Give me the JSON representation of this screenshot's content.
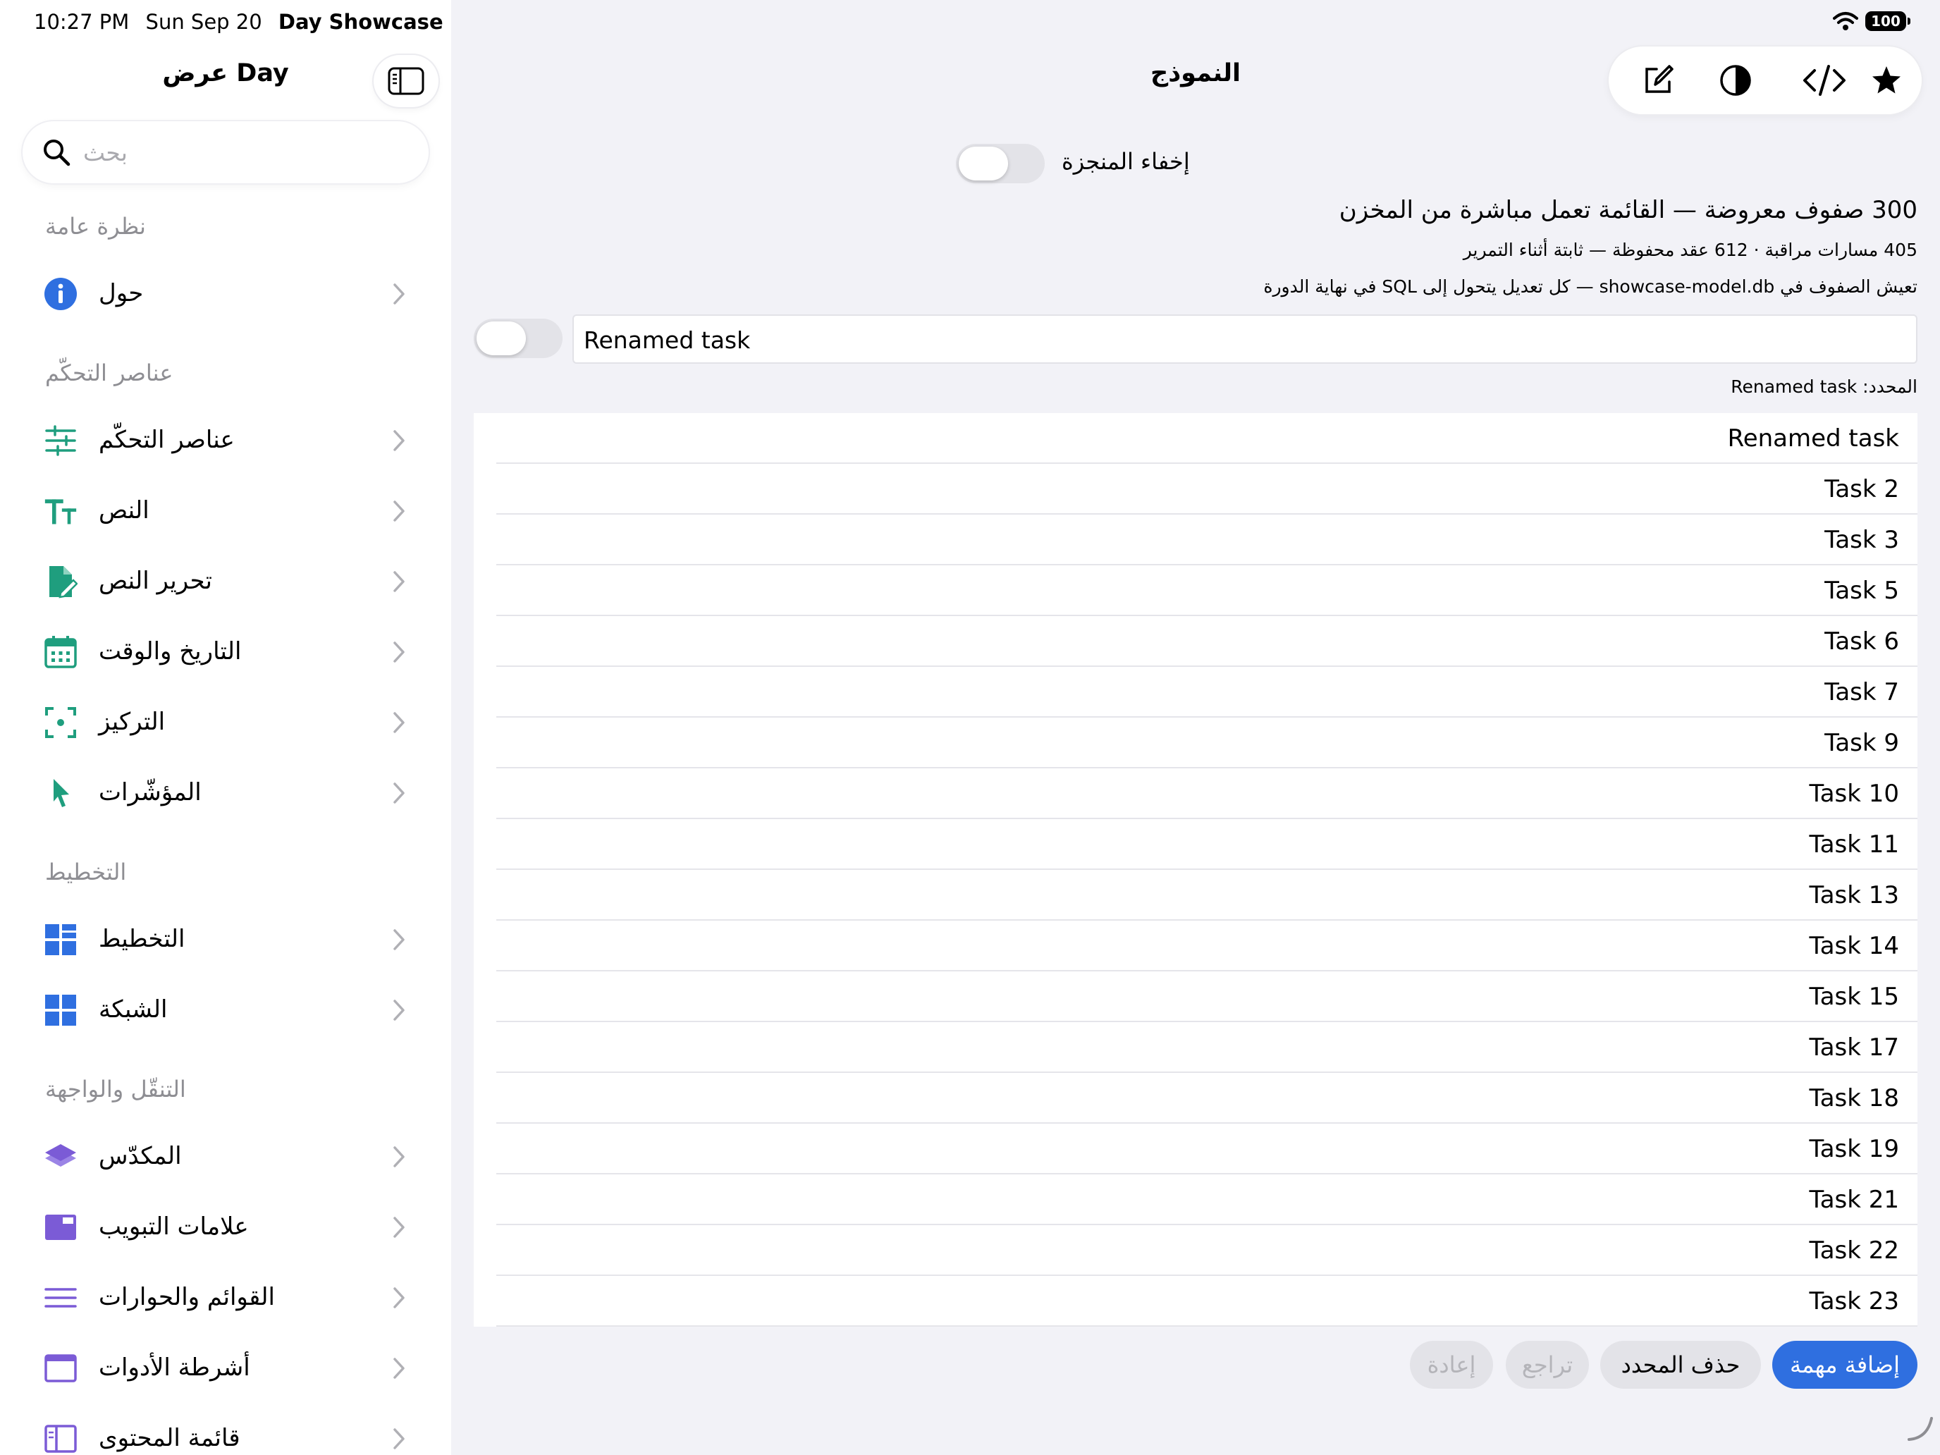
{
  "status_bar": {
    "time": "10:27 PM",
    "date": "Sun Sep 20",
    "app_name": "Day Showcase",
    "battery": "100"
  },
  "sidebar": {
    "title": "عرض Day",
    "search_placeholder": "بحث",
    "sections": [
      {
        "title": "نظرة عامة"
      },
      {
        "title": "عناصر التحكّم"
      },
      {
        "title": "التخطيط"
      },
      {
        "title": "التنقّل والواجهة"
      }
    ],
    "items": [
      {
        "label": "حول",
        "icon": "info-icon",
        "color": "#2f6fe0"
      },
      {
        "label": "عناصر التحكّم",
        "icon": "sliders-icon",
        "color": "#1f9e7e"
      },
      {
        "label": "النص",
        "icon": "text-size-icon",
        "color": "#1f9e7e"
      },
      {
        "label": "تحرير النص",
        "icon": "document-edit-icon",
        "color": "#1f9e7e"
      },
      {
        "label": "التاريخ والوقت",
        "icon": "calendar-icon",
        "color": "#1f9e7e"
      },
      {
        "label": "التركيز",
        "icon": "focus-icon",
        "color": "#1f9e7e"
      },
      {
        "label": "المؤشّرات",
        "icon": "pointer-icon",
        "color": "#1f9e7e"
      },
      {
        "label": "التخطيط",
        "icon": "layout-icon",
        "color": "#2f6fe0"
      },
      {
        "label": "الشبكة",
        "icon": "grid-icon",
        "color": "#2f6fe0"
      },
      {
        "label": "المكدّس",
        "icon": "stack-icon",
        "color": "#7b5bd6"
      },
      {
        "label": "علامات التبويب",
        "icon": "tabs-icon",
        "color": "#7b5bd6"
      },
      {
        "label": "القوائم والحوارات",
        "icon": "menu-lines-icon",
        "color": "#7b5bd6"
      },
      {
        "label": "أشرطة الأدوات",
        "icon": "toolbar-window-icon",
        "color": "#7b5bd6"
      },
      {
        "label": "قائمة المحتوى",
        "icon": "sidebar-list-icon",
        "color": "#7b5bd6"
      }
    ]
  },
  "main": {
    "title": "النموذج",
    "toolbar": [
      "compose-icon",
      "contrast-icon",
      "code-icon",
      "star-icon"
    ],
    "hide_completed_label": "إخفاء المنجزة",
    "hide_completed_on": false,
    "stats_big": "300 صفوف معروضة — القائمة تعمل مباشرة من المخزن",
    "stats_small": "405 مسارات مراقبة · 612 عقد محفوظة — ثابتة أثناء التمرير",
    "stats_note": "تعيش الصفوف في showcase-model.db — كل تعديل يتحول إلى SQL في نهاية الدورة",
    "task_done": false,
    "task_value": "Renamed task",
    "selected_text": "المحدد: Renamed task",
    "tasks": [
      "Renamed task",
      "Task 2",
      "Task 3",
      "Task 5",
      "Task 6",
      "Task 7",
      "Task 9",
      "Task 10",
      "Task 11",
      "Task 13",
      "Task 14",
      "Task 15",
      "Task 17",
      "Task 18",
      "Task 19",
      "Task 21",
      "Task 22",
      "Task 23"
    ],
    "buttons": {
      "add": "إضافة مهمة",
      "delete": "حذف المحدد",
      "undo": "تراجع",
      "redo": "إعادة"
    },
    "accent_color": "#2f6fe0"
  }
}
